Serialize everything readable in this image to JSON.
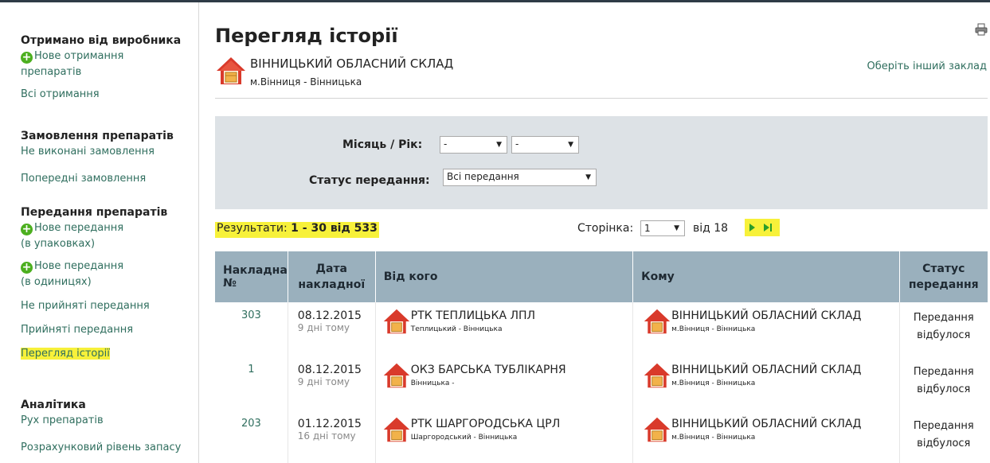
{
  "sidebar": {
    "received": {
      "heading": "Отримано від виробника",
      "new_label": "Нове отримання препаратів",
      "all_label": "Всі отримання"
    },
    "orders": {
      "heading": "Замовлення препаратів",
      "pending_label": "Не виконані замовлення",
      "previous_label": "Попередні замовлення"
    },
    "transfers": {
      "heading": "Передання препаратів",
      "new_packages_line1": "Нове передання",
      "new_packages_line2": "(в упаковках)",
      "new_units_line1": "Нове передання",
      "new_units_line2": "(в одиницях)",
      "not_accepted_label": "Не прийняті передання",
      "accepted_label": "Прийняті передання",
      "history_label": "Перегляд історії"
    },
    "analytics": {
      "heading": "Аналітика",
      "movement_label": "Рух препаратів",
      "stock_level_label": "Розрахунковий рівень запасу"
    }
  },
  "header": {
    "title": "Перегляд історії",
    "org_name": "ВІННИЦЬКИЙ ОБЛАСНИЙ СКЛАД",
    "org_city": "м.Вінниця - Вінницька",
    "change_org_label": "Оберіть інший заклад"
  },
  "filters": {
    "month_year_label": "Місяць / Рік:",
    "month_value": "-",
    "year_value": "-",
    "status_label": "Статус передання:",
    "status_value": "Всі передання"
  },
  "results": {
    "label": "Результати:",
    "range": "1 - 30 від 533"
  },
  "pager": {
    "page_label": "Сторінка:",
    "page_value": "1",
    "of_label": "від 18"
  },
  "table": {
    "headers": {
      "invoice_line1": "Накладна",
      "invoice_line2": "№",
      "date_line1": "Дата",
      "date_line2": "накладної",
      "from": "Від кого",
      "to": "Кому",
      "status_line1": "Статус",
      "status_line2": "передання"
    },
    "rows": [
      {
        "number": "303",
        "date": "08.12.2015",
        "ago": "9 дні тому",
        "from_name": "РТК ТЕПЛИЦЬКА ЛПЛ",
        "from_loc": "Теплицький - Вінницька",
        "to_name": "ВІННИЦЬКИЙ ОБЛАСНИЙ СКЛАД",
        "to_loc": "м.Вінниця - Вінницька",
        "status_line1": "Передання",
        "status_line2": "відбулося"
      },
      {
        "number": "1",
        "date": "08.12.2015",
        "ago": "9 дні тому",
        "from_name": "ОКЗ БАРСЬКА ТУБЛІКАРНЯ",
        "from_loc": "Вінницька -",
        "to_name": "ВІННИЦЬКИЙ ОБЛАСНИЙ СКЛАД",
        "to_loc": "м.Вінниця - Вінницька",
        "status_line1": "Передання",
        "status_line2": "відбулося"
      },
      {
        "number": "203",
        "date": "01.12.2015",
        "ago": "16 дні тому",
        "from_name": "РТК ШАРГОРОДСЬКА ЦРЛ",
        "from_loc": "Шаргородський - Вінницька",
        "to_name": "ВІННИЦЬКИЙ ОБЛАСНИЙ СКЛАД",
        "to_loc": "м.Вінниця - Вінницька",
        "status_line1": "Передання",
        "status_line2": "відбулося"
      }
    ]
  },
  "colors": {
    "link": "#2f6e5e",
    "highlight": "#f7f13a",
    "table_header": "#9ab0bd",
    "filter_panel": "#dde2e6",
    "plus_icon": "#4caf1f"
  },
  "icons": {
    "plus": "plus-circle-icon",
    "print": "printer-icon",
    "house": "house-box-icon",
    "next": "next-page-icon",
    "last": "last-page-icon"
  }
}
